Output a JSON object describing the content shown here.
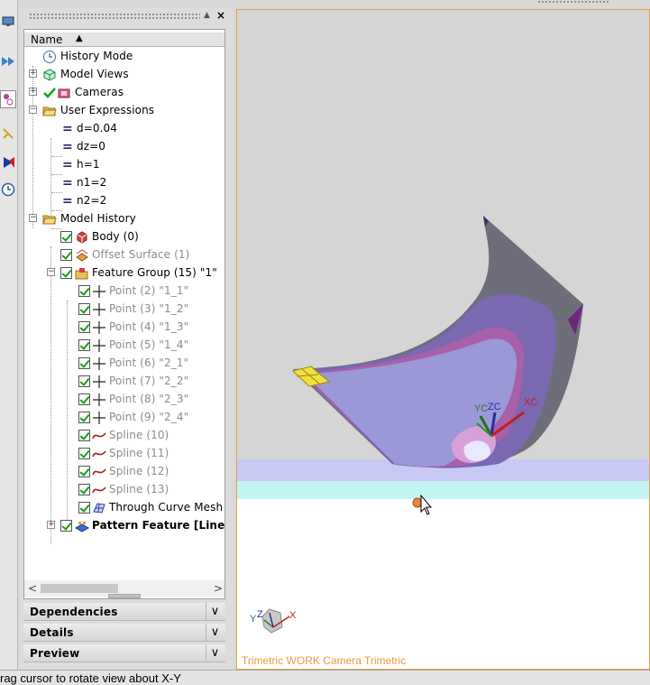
{
  "navigator": {
    "column_header": "Name",
    "sort_indicator": "▲",
    "close_glyph": "×",
    "pin_glyph": "▲",
    "tree": [
      {
        "label": "History Mode",
        "icon": "clock-icon"
      },
      {
        "label": "Model Views",
        "icon": "views-icon"
      },
      {
        "label": "Cameras",
        "icon": "camera-icon"
      },
      {
        "label": "User Expressions",
        "icon": "folder-open-icon"
      },
      {
        "label": "d=0.04",
        "icon": "expression-icon"
      },
      {
        "label": "dz=0",
        "icon": "expression-icon"
      },
      {
        "label": "h=1",
        "icon": "expression-icon"
      },
      {
        "label": "n1=2",
        "icon": "expression-icon"
      },
      {
        "label": "n2=2",
        "icon": "expression-icon"
      },
      {
        "label": "Model History",
        "icon": "folder-open-icon"
      },
      {
        "label": "Body (0)",
        "icon": "body-icon"
      },
      {
        "label": "Offset Surface (1)",
        "icon": "offset-surface-icon"
      },
      {
        "label": "Feature Group (15) \"1\"",
        "icon": "feature-group-icon"
      },
      {
        "label": "Point (2) \"1_1\"",
        "icon": "point-icon"
      },
      {
        "label": "Point (3) \"1_2\"",
        "icon": "point-icon"
      },
      {
        "label": "Point (4) \"1_3\"",
        "icon": "point-icon"
      },
      {
        "label": "Point (5) \"1_4\"",
        "icon": "point-icon"
      },
      {
        "label": "Point (6) \"2_1\"",
        "icon": "point-icon"
      },
      {
        "label": "Point (7) \"2_2\"",
        "icon": "point-icon"
      },
      {
        "label": "Point (8) \"2_3\"",
        "icon": "point-icon"
      },
      {
        "label": "Point (9) \"2_4\"",
        "icon": "point-icon"
      },
      {
        "label": "Spline (10)",
        "icon": "spline-icon"
      },
      {
        "label": "Spline (11)",
        "icon": "spline-icon"
      },
      {
        "label": "Spline (12)",
        "icon": "spline-icon"
      },
      {
        "label": "Spline (13)",
        "icon": "spline-icon"
      },
      {
        "label": "Through Curve Mesh (",
        "icon": "through-curve-mesh-icon"
      },
      {
        "label": "Pattern Feature [Linear",
        "icon": "pattern-feature-icon"
      }
    ],
    "scroll_left": "<",
    "scroll_right": ">",
    "panels": [
      {
        "label": "Dependencies",
        "chevron": "∨"
      },
      {
        "label": "Details",
        "chevron": "∨"
      },
      {
        "label": "Preview",
        "chevron": "∨"
      }
    ]
  },
  "viewport": {
    "caption": "Trimetric WORK Camera Trimetric",
    "csys_labels": {
      "yc": "YC",
      "zc": "ZC",
      "xc": "XC"
    },
    "triad_labels": {
      "y": "Y",
      "z": "Z",
      "x": "X"
    },
    "colors": {
      "background_top": "#d5d5d5",
      "band_lavender": "#c8c8f4",
      "band_cyan": "#c4f4f4",
      "surface_dark": "#6e6e7a",
      "surface_purple": "#7a68b0",
      "surface_light": "#9a98d6",
      "highlight_yellow": "#f2e040",
      "accent_orange": "#e89a40"
    }
  },
  "status": {
    "text": "rag cursor to rotate view about X-Y"
  }
}
